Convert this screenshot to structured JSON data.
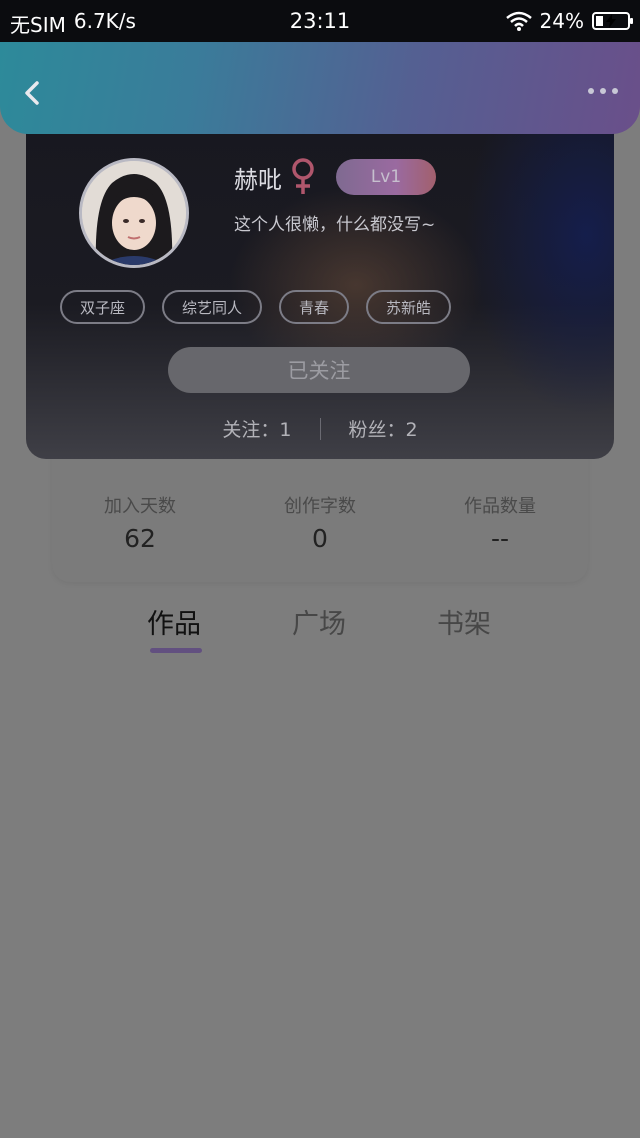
{
  "status_bar": {
    "carrier": "无SIM",
    "net_speed": "6.7K/s",
    "time": "23:11",
    "battery": "24%",
    "battery_level": 0.24
  },
  "header": {
    "back_icon": "chevron-left-icon",
    "more_icon": "more-dots-icon"
  },
  "profile": {
    "name": "赫吡",
    "gender_icon": "female-icon",
    "level": "Lv1",
    "bio": "这个人很懒，什么都没写~",
    "tags": [
      "双子座",
      "综艺同人",
      "青春",
      "苏新皓"
    ],
    "follow_button": "已关注",
    "following": "关注：1",
    "followers": "粉丝：2"
  },
  "stats": [
    {
      "label": "加入天数",
      "value": "62"
    },
    {
      "label": "创作字数",
      "value": "0"
    },
    {
      "label": "作品数量",
      "value": "--"
    }
  ],
  "tabs": [
    {
      "label": "作品",
      "active": true
    },
    {
      "label": "广场",
      "active": false
    },
    {
      "label": "书架",
      "active": false
    }
  ],
  "colors": {
    "header_start": "#2d8a9a",
    "header_end": "#6a4f8a",
    "gender_icon": "#b0566c",
    "level_badge": "#9a6aa0",
    "tab_indicator": "#625080"
  }
}
